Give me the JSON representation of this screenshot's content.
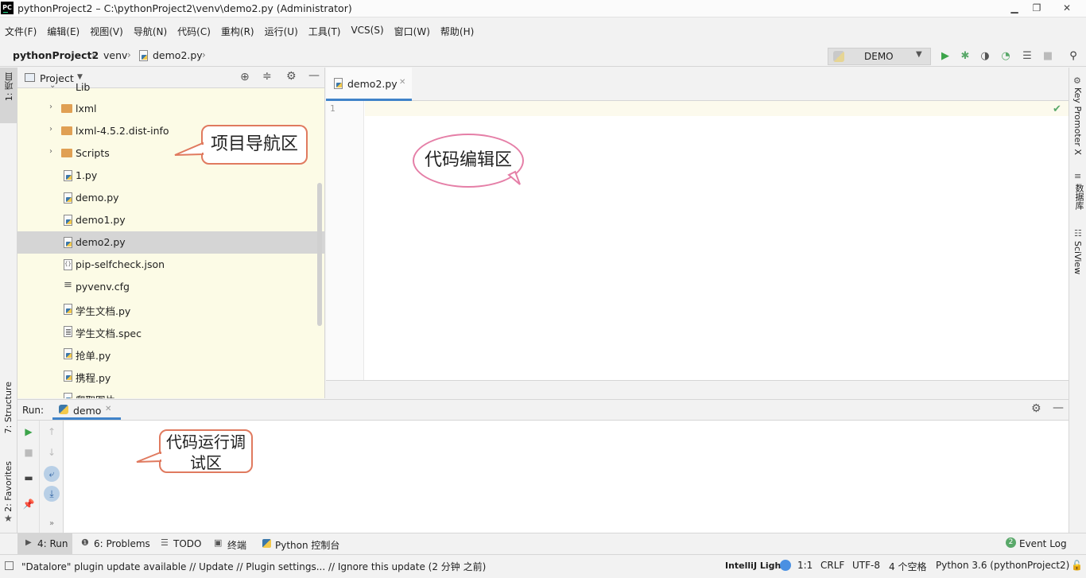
{
  "window": {
    "app_icon_text": "PC",
    "title": "pythonProject2 – C:\\pythonProject2\\venv\\demo2.py (Administrator)",
    "minimize_icon": "minimize-icon",
    "maximize_icon": "restore-icon",
    "close_icon": "close-icon"
  },
  "menu": [
    "文件(F)",
    "编辑(E)",
    "视图(V)",
    "导航(N)",
    "代码(C)",
    "重构(R)",
    "运行(U)",
    "工具(T)",
    "VCS(S)",
    "窗口(W)",
    "帮助(H)"
  ],
  "breadcrumb": {
    "project": "pythonProject2",
    "folder": "venv",
    "file": "demo2.py"
  },
  "run_config": {
    "label": "DEMO"
  },
  "left_stripe": {
    "project_tab": "1: 项目",
    "structure_tab": "7: Structure",
    "favorites_tab": "2: Favorites"
  },
  "right_stripe": {
    "key_promoter": "Key Promoter X",
    "database": "数据库",
    "sciview": "SciView"
  },
  "project_panel": {
    "title": "Project",
    "tree": [
      {
        "label": "Lib",
        "type": "folder",
        "expandable": true,
        "partial": true
      },
      {
        "label": "lxml",
        "type": "folder",
        "expandable": true
      },
      {
        "label": "lxml-4.5.2.dist-info",
        "type": "folder",
        "expandable": true
      },
      {
        "label": "Scripts",
        "type": "folder",
        "expandable": true
      },
      {
        "label": "1.py",
        "type": "py"
      },
      {
        "label": "demo.py",
        "type": "py"
      },
      {
        "label": "demo1.py",
        "type": "py"
      },
      {
        "label": "demo2.py",
        "type": "py",
        "selected": true
      },
      {
        "label": "pip-selfcheck.json",
        "type": "json"
      },
      {
        "label": "pyvenv.cfg",
        "type": "cfg"
      },
      {
        "label": "学生文档.py",
        "type": "py"
      },
      {
        "label": "学生文档.spec",
        "type": "spec"
      },
      {
        "label": "抢单.py",
        "type": "py"
      },
      {
        "label": "携程.py",
        "type": "py"
      },
      {
        "label": "爬取图片.py",
        "type": "py",
        "partial": true
      }
    ]
  },
  "callouts": {
    "project_nav": "项目导航区",
    "code_edit": "代码编辑区",
    "run_debug_line1": "代码运行调",
    "run_debug_line2": "试区"
  },
  "editor": {
    "tab_label": "demo2.py",
    "line_number": "1"
  },
  "run_panel": {
    "label": "Run:",
    "tab": "demo"
  },
  "bottom_tabs": [
    {
      "label": "4: Run",
      "icon": "play-icon",
      "active": true
    },
    {
      "label": "6: Problems",
      "icon": "info-icon"
    },
    {
      "label": "TODO",
      "icon": "list-icon"
    },
    {
      "label": "终端",
      "icon": "terminal-icon"
    },
    {
      "label": "Python 控制台",
      "icon": "python-icon"
    }
  ],
  "event_log": {
    "count": "2",
    "label": "Event Log"
  },
  "status_bar": {
    "message": "\"Datalore\" plugin update available // Update // Plugin settings... // Ignore this update (2 分钟 之前)",
    "theme": "IntelliJ Light",
    "position": "1:1",
    "line_sep": "CRLF",
    "encoding": "UTF-8",
    "indent": "4 个空格",
    "interpreter": "Python 3.6 (pythonProject2)"
  },
  "colors": {
    "project_bg": "#fcfbe6",
    "accent": "#4083c9",
    "run_green": "#3ca44a",
    "debug_green": "#59a869"
  }
}
